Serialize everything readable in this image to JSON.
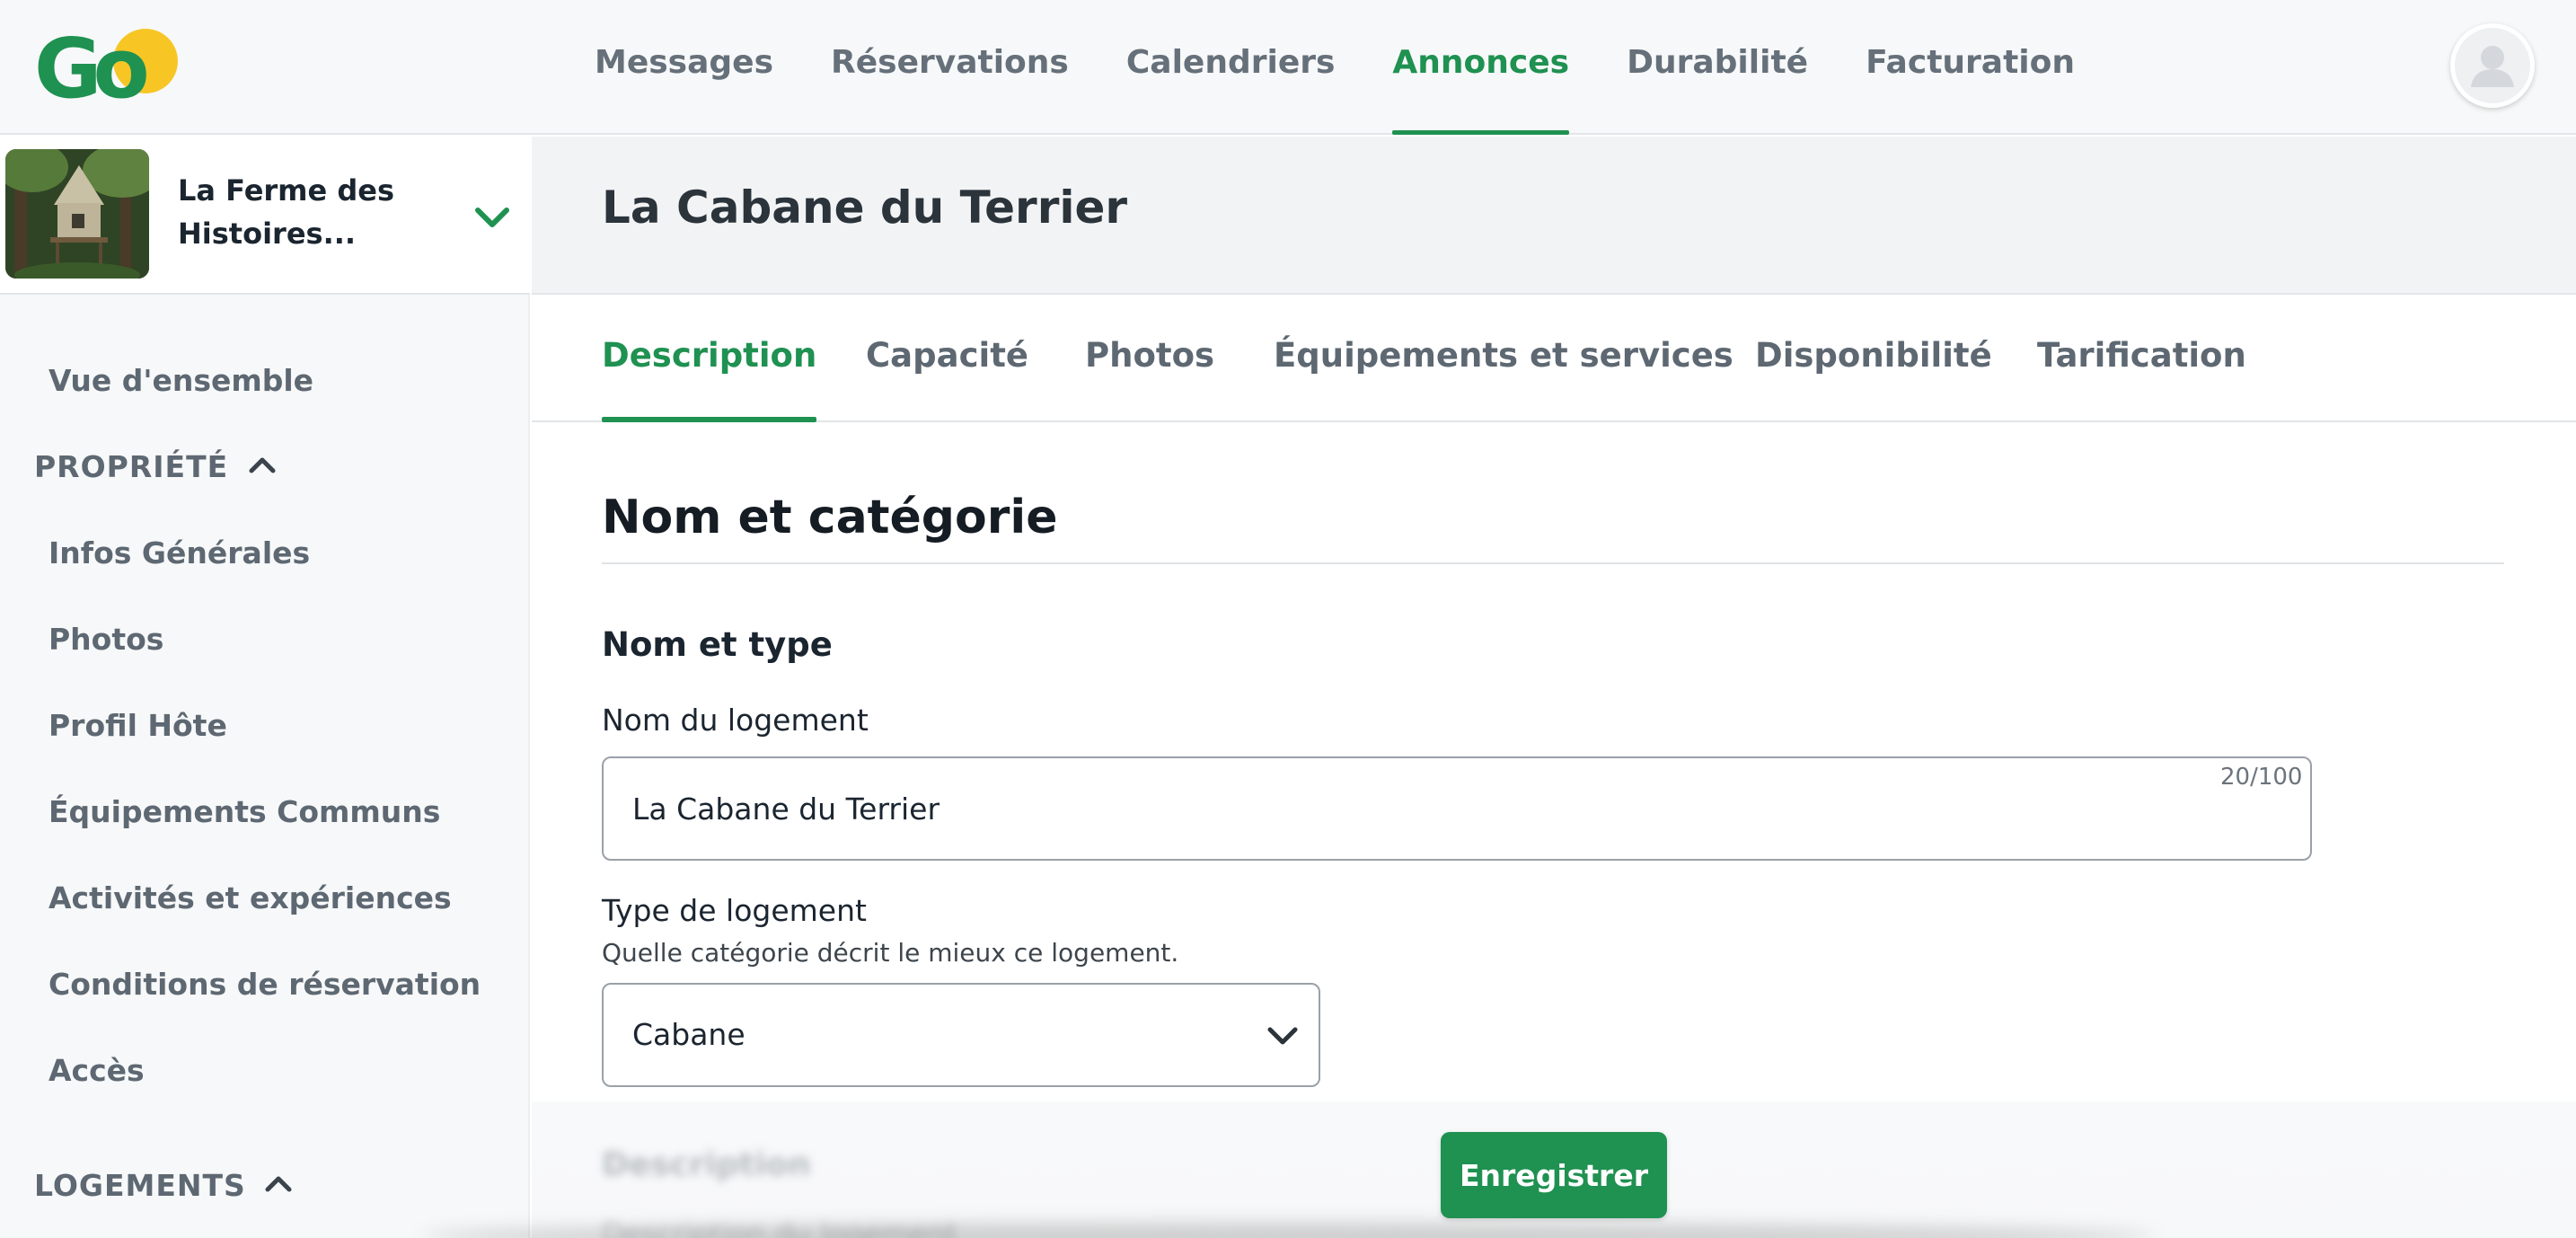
{
  "app": {
    "logo_text": "Go",
    "brand_color": "#1f9151",
    "logo_sun_color": "#f7c625"
  },
  "topnav": {
    "items": [
      {
        "label": "Messages",
        "active": false
      },
      {
        "label": "Réservations",
        "active": false
      },
      {
        "label": "Calendriers",
        "active": false
      },
      {
        "label": "Annonces",
        "active": true
      },
      {
        "label": "Durabilité",
        "active": false
      },
      {
        "label": "Facturation",
        "active": false
      }
    ],
    "avatar_icon": "user-avatar-icon"
  },
  "sidebar": {
    "property_name": "La Ferme des Histoires...",
    "property_chevron_icon": "chevron-down-icon",
    "overview_label": "Vue d'ensemble",
    "property_section": {
      "label": "PROPRIÉTÉ",
      "items": [
        "Infos Générales",
        "Photos",
        "Profil Hôte",
        "Équipements Communs",
        "Activités et expériences",
        "Conditions de réservation",
        "Accès"
      ]
    },
    "lodging_section": {
      "label": "LOGEMENTS"
    }
  },
  "main": {
    "title": "La Cabane du Terrier",
    "tabs": [
      {
        "label": "Description",
        "active": true
      },
      {
        "label": "Capacité",
        "active": false
      },
      {
        "label": "Photos",
        "active": false
      },
      {
        "label": "Équipements et services",
        "active": false
      },
      {
        "label": "Disponibilité",
        "active": false
      },
      {
        "label": "Tarification",
        "active": false
      }
    ],
    "section_title": "Nom et catégorie",
    "subsection_title": "Nom et type",
    "name_field": {
      "label": "Nom du logement",
      "value": "La Cabane du Terrier",
      "char_count": "20/100"
    },
    "type_field": {
      "label": "Type de logement",
      "hint": "Quelle catégorie décrit le mieux ce logement.",
      "selected": "Cabane"
    },
    "blurred_heading": "Description",
    "blurred_label": "Description du logement"
  },
  "footer": {
    "save_label": "Enregistrer"
  }
}
